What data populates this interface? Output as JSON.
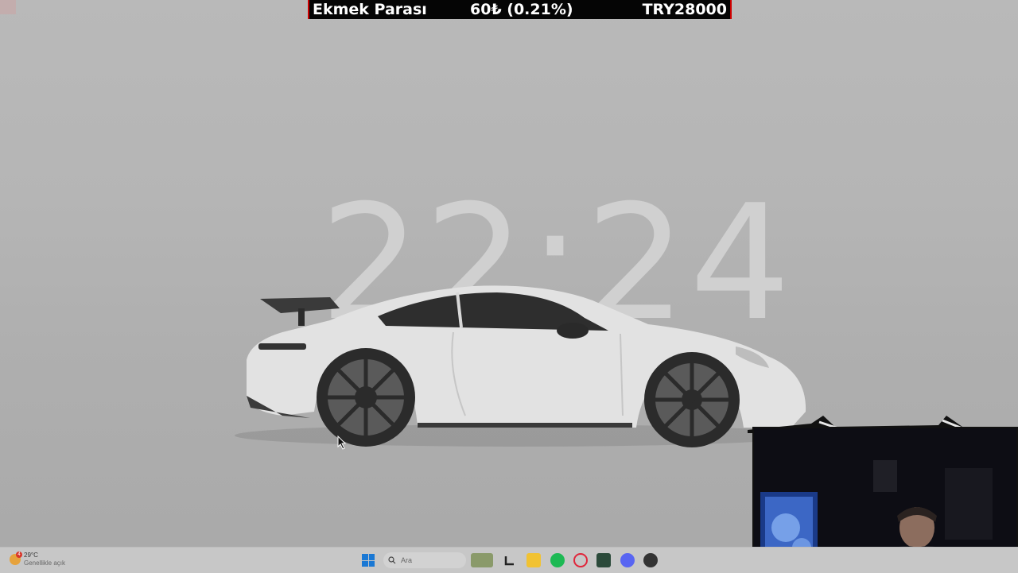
{
  "ticker": {
    "name": "Ekmek Parası",
    "change": "60₺ (0.21%)",
    "total": "TRY28000"
  },
  "desktop": {
    "clock": "22:24"
  },
  "taskbar": {
    "weather_temp": "29°C",
    "weather_desc": "Genellikle açık",
    "weather_badge": "4",
    "search_placeholder": "Ara",
    "apps": [
      "file-explorer-alt-icon",
      "terminal-icon",
      "folder-icon",
      "spotify-icon",
      "opera-icon",
      "league-of-legends-icon",
      "discord-icon",
      "misc-app-icon"
    ]
  },
  "colors": {
    "accent": "#1a78d4",
    "ticker_bg": "#050505",
    "ticker_border": "#cc0000"
  }
}
